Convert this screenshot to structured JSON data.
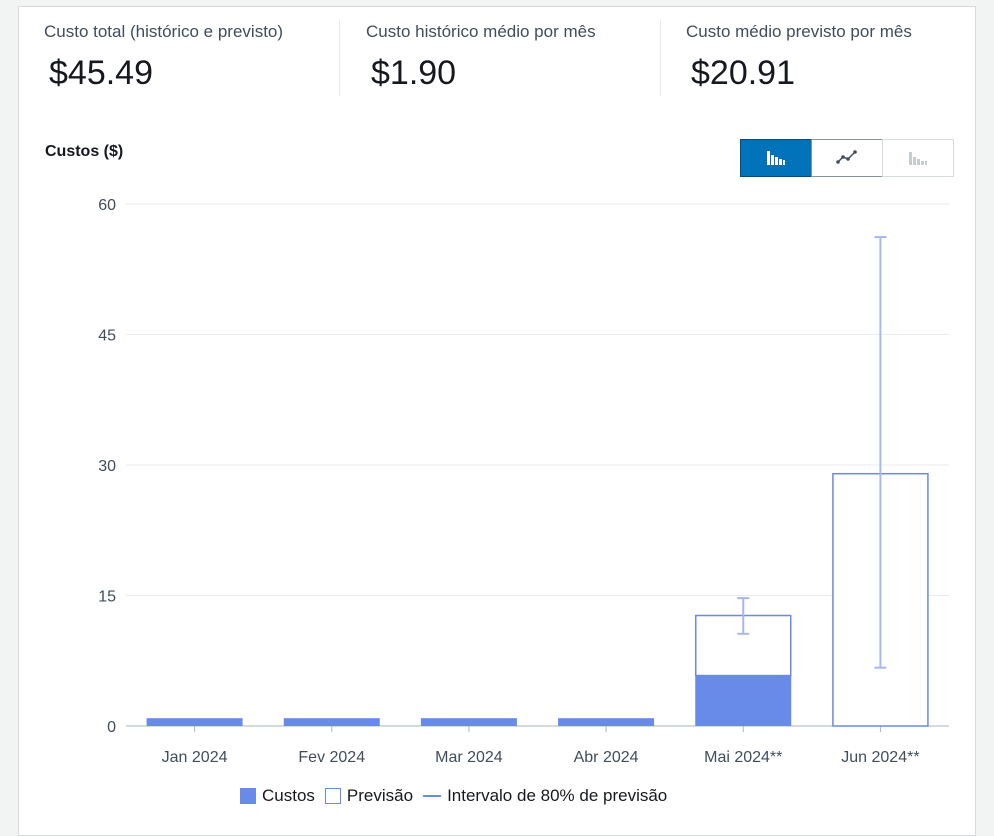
{
  "summary": {
    "total_label": "Custo total (histórico e previsto)",
    "total_value": "$45.49",
    "hist_label": "Custo histórico médio por mês",
    "hist_value": "$1.90",
    "forecast_label": "Custo médio previsto por mês",
    "forecast_value": "$20.91"
  },
  "chart_title": "Custos ($)",
  "view_toggle": [
    {
      "icon": "bar-chart-icon",
      "active": true
    },
    {
      "icon": "line-chart-icon",
      "active": false
    },
    {
      "icon": "stacked-bar-chart-icon",
      "active": false,
      "disabled": true
    }
  ],
  "legend": {
    "costs": "Custos",
    "forecast": "Previsão",
    "interval": "Intervalo de 80% de previsão"
  },
  "colors": {
    "costs": "#688ae8",
    "interval": "#a4b9f1",
    "grid": "#e9ebed",
    "active_toggle": "#0073bb"
  },
  "chart_data": {
    "type": "bar",
    "title": "Costs ($)",
    "ylabel": "Custos ($)",
    "xlabel": "",
    "ylim": [
      0,
      60
    ],
    "yticks": [
      0,
      15,
      30,
      45,
      60
    ],
    "grid": true,
    "legend_position": "bottom",
    "categories": [
      "Jan 2024",
      "Fev 2024",
      "Mar 2024",
      "Abr 2024",
      "Mai 2024**",
      "Jun 2024**"
    ],
    "series": [
      {
        "name": "Custos",
        "values": [
          0.9,
          0.9,
          0.9,
          0.9,
          5.8,
          0
        ]
      },
      {
        "name": "Previsão",
        "values": [
          0,
          0,
          0,
          0,
          6.9,
          29.0
        ]
      }
    ],
    "interval_80": [
      null,
      null,
      null,
      null,
      [
        10.6,
        14.7
      ],
      [
        6.7,
        56.2
      ]
    ]
  }
}
